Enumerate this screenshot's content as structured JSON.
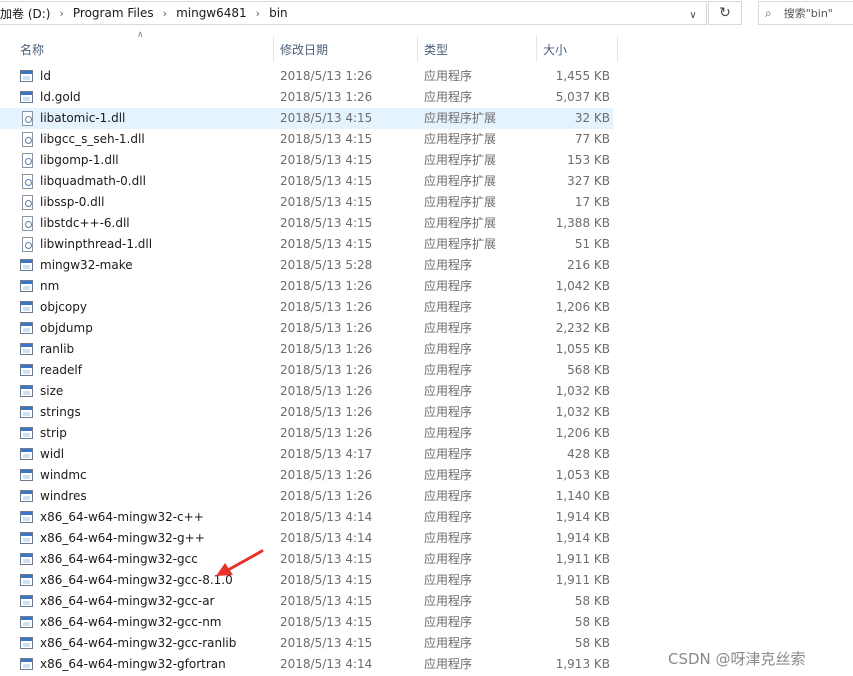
{
  "address": {
    "crumbs": [
      "加卷 (D:)",
      "Program Files",
      "mingw6481",
      "bin"
    ]
  },
  "search": {
    "placeholder": "搜索\"bin\""
  },
  "columns": {
    "name": "名称",
    "date": "修改日期",
    "type": "类型",
    "size": "大小"
  },
  "files": [
    {
      "name": "ld",
      "date": "2018/5/13 1:26",
      "type": "应用程序",
      "size": "1,455 KB",
      "icon": "exe"
    },
    {
      "name": "ld.gold",
      "date": "2018/5/13 1:26",
      "type": "应用程序",
      "size": "5,037 KB",
      "icon": "exe"
    },
    {
      "name": "libatomic-1.dll",
      "date": "2018/5/13 4:15",
      "type": "应用程序扩展",
      "size": "32 KB",
      "icon": "dll",
      "selected": true
    },
    {
      "name": "libgcc_s_seh-1.dll",
      "date": "2018/5/13 4:15",
      "type": "应用程序扩展",
      "size": "77 KB",
      "icon": "dll"
    },
    {
      "name": "libgomp-1.dll",
      "date": "2018/5/13 4:15",
      "type": "应用程序扩展",
      "size": "153 KB",
      "icon": "dll"
    },
    {
      "name": "libquadmath-0.dll",
      "date": "2018/5/13 4:15",
      "type": "应用程序扩展",
      "size": "327 KB",
      "icon": "dll"
    },
    {
      "name": "libssp-0.dll",
      "date": "2018/5/13 4:15",
      "type": "应用程序扩展",
      "size": "17 KB",
      "icon": "dll"
    },
    {
      "name": "libstdc++-6.dll",
      "date": "2018/5/13 4:15",
      "type": "应用程序扩展",
      "size": "1,388 KB",
      "icon": "dll"
    },
    {
      "name": "libwinpthread-1.dll",
      "date": "2018/5/13 4:15",
      "type": "应用程序扩展",
      "size": "51 KB",
      "icon": "dll"
    },
    {
      "name": "mingw32-make",
      "date": "2018/5/13 5:28",
      "type": "应用程序",
      "size": "216 KB",
      "icon": "exe"
    },
    {
      "name": "nm",
      "date": "2018/5/13 1:26",
      "type": "应用程序",
      "size": "1,042 KB",
      "icon": "exe"
    },
    {
      "name": "objcopy",
      "date": "2018/5/13 1:26",
      "type": "应用程序",
      "size": "1,206 KB",
      "icon": "exe"
    },
    {
      "name": "objdump",
      "date": "2018/5/13 1:26",
      "type": "应用程序",
      "size": "2,232 KB",
      "icon": "exe"
    },
    {
      "name": "ranlib",
      "date": "2018/5/13 1:26",
      "type": "应用程序",
      "size": "1,055 KB",
      "icon": "exe"
    },
    {
      "name": "readelf",
      "date": "2018/5/13 1:26",
      "type": "应用程序",
      "size": "568 KB",
      "icon": "exe"
    },
    {
      "name": "size",
      "date": "2018/5/13 1:26",
      "type": "应用程序",
      "size": "1,032 KB",
      "icon": "exe"
    },
    {
      "name": "strings",
      "date": "2018/5/13 1:26",
      "type": "应用程序",
      "size": "1,032 KB",
      "icon": "exe"
    },
    {
      "name": "strip",
      "date": "2018/5/13 1:26",
      "type": "应用程序",
      "size": "1,206 KB",
      "icon": "exe"
    },
    {
      "name": "widl",
      "date": "2018/5/13 4:17",
      "type": "应用程序",
      "size": "428 KB",
      "icon": "exe"
    },
    {
      "name": "windmc",
      "date": "2018/5/13 1:26",
      "type": "应用程序",
      "size": "1,053 KB",
      "icon": "exe"
    },
    {
      "name": "windres",
      "date": "2018/5/13 1:26",
      "type": "应用程序",
      "size": "1,140 KB",
      "icon": "exe"
    },
    {
      "name": "x86_64-w64-mingw32-c++",
      "date": "2018/5/13 4:14",
      "type": "应用程序",
      "size": "1,914 KB",
      "icon": "exe"
    },
    {
      "name": "x86_64-w64-mingw32-g++",
      "date": "2018/5/13 4:14",
      "type": "应用程序",
      "size": "1,914 KB",
      "icon": "exe"
    },
    {
      "name": "x86_64-w64-mingw32-gcc",
      "date": "2018/5/13 4:15",
      "type": "应用程序",
      "size": "1,911 KB",
      "icon": "exe"
    },
    {
      "name": "x86_64-w64-mingw32-gcc-8.1.0",
      "date": "2018/5/13 4:15",
      "type": "应用程序",
      "size": "1,911 KB",
      "icon": "exe"
    },
    {
      "name": "x86_64-w64-mingw32-gcc-ar",
      "date": "2018/5/13 4:15",
      "type": "应用程序",
      "size": "58 KB",
      "icon": "exe"
    },
    {
      "name": "x86_64-w64-mingw32-gcc-nm",
      "date": "2018/5/13 4:15",
      "type": "应用程序",
      "size": "58 KB",
      "icon": "exe"
    },
    {
      "name": "x86_64-w64-mingw32-gcc-ranlib",
      "date": "2018/5/13 4:15",
      "type": "应用程序",
      "size": "58 KB",
      "icon": "exe"
    },
    {
      "name": "x86_64-w64-mingw32-gfortran",
      "date": "2018/5/13 4:14",
      "type": "应用程序",
      "size": "1,913 KB",
      "icon": "exe"
    }
  ],
  "watermark": "CSDN @呀津克丝索",
  "colors": {
    "selection": "#e5f3ff",
    "annotation_arrow": "#e8322a",
    "header_text": "#4c607a"
  }
}
